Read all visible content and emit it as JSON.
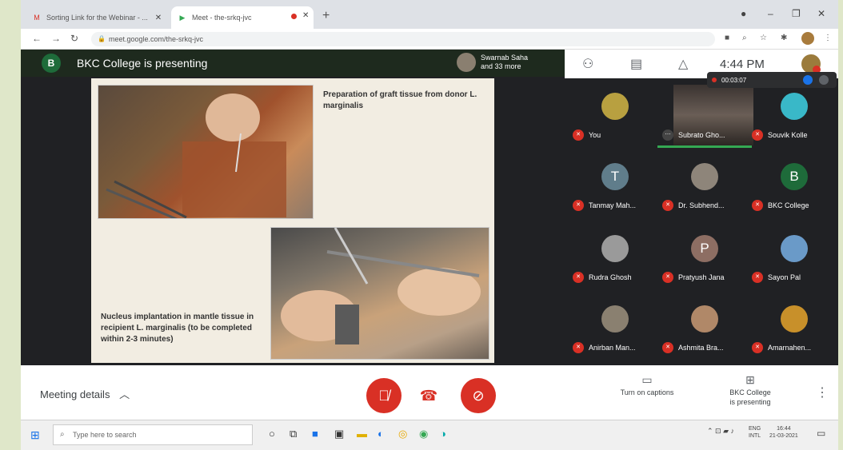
{
  "browser": {
    "tabs": [
      {
        "title": "Sorting Link for the Webinar - ...",
        "favicon": "gmail-icon",
        "color": "#d93025"
      },
      {
        "title": "Meet - the-srkq-jvc",
        "favicon": "meet-icon",
        "color": "#34a853"
      }
    ],
    "url": "meet.google.com/the-srkq-jvc",
    "window_controls": {
      "minimize": "–",
      "restore": "❐",
      "close": "✕"
    }
  },
  "presenter": {
    "avatar_letter": "B",
    "banner": "BKC College is presenting",
    "host_name": "Swarnab Saha",
    "host_more": "and 33 more"
  },
  "slide": {
    "caption_top": "Preparation of graft tissue from donor L. marginalis",
    "caption_bottom": "Nucleus implantation in mantle tissue in recipient L. marginalis (to be completed within 2-3 minutes)"
  },
  "right_bar": {
    "time": "4:44 PM",
    "recording_time": "00:03:07"
  },
  "participants": [
    {
      "name": "You",
      "avatar": "",
      "color": "#b8a040"
    },
    {
      "name": "Subrato Gho...",
      "avatar": "",
      "color": "#5a4d44"
    },
    {
      "name": "Souvik Kolle",
      "avatar": "",
      "color": "#39b8c8"
    },
    {
      "name": "Tanmay Mah...",
      "avatar": "T",
      "color": "#607d8b"
    },
    {
      "name": "Dr. Subhend...",
      "avatar": "",
      "color": "#8e857a"
    },
    {
      "name": "BKC College",
      "avatar": "B",
      "color": "#1e6b3a"
    },
    {
      "name": "Rudra Ghosh",
      "avatar": "",
      "color": "#9a9a9a"
    },
    {
      "name": "Pratyush Jana",
      "avatar": "P",
      "color": "#8d6e63"
    },
    {
      "name": "Sayon Pal",
      "avatar": "",
      "color": "#6a9ac8"
    },
    {
      "name": "Anirban Man...",
      "avatar": "",
      "color": "#8a8070"
    },
    {
      "name": "Ashmita Bra...",
      "avatar": "",
      "color": "#b08868"
    },
    {
      "name": "Amarnahen...",
      "avatar": "",
      "color": "#c8902a"
    }
  ],
  "toolbar": {
    "meeting_details": "Meeting details",
    "captions_label": "Turn on captions",
    "presenting_label_1": "BKC College",
    "presenting_label_2": "is presenting"
  },
  "taskbar": {
    "search_placeholder": "Type here to search",
    "lang_1": "ENG",
    "lang_2": "INTL",
    "time": "16:44",
    "date": "21-03-2021"
  }
}
